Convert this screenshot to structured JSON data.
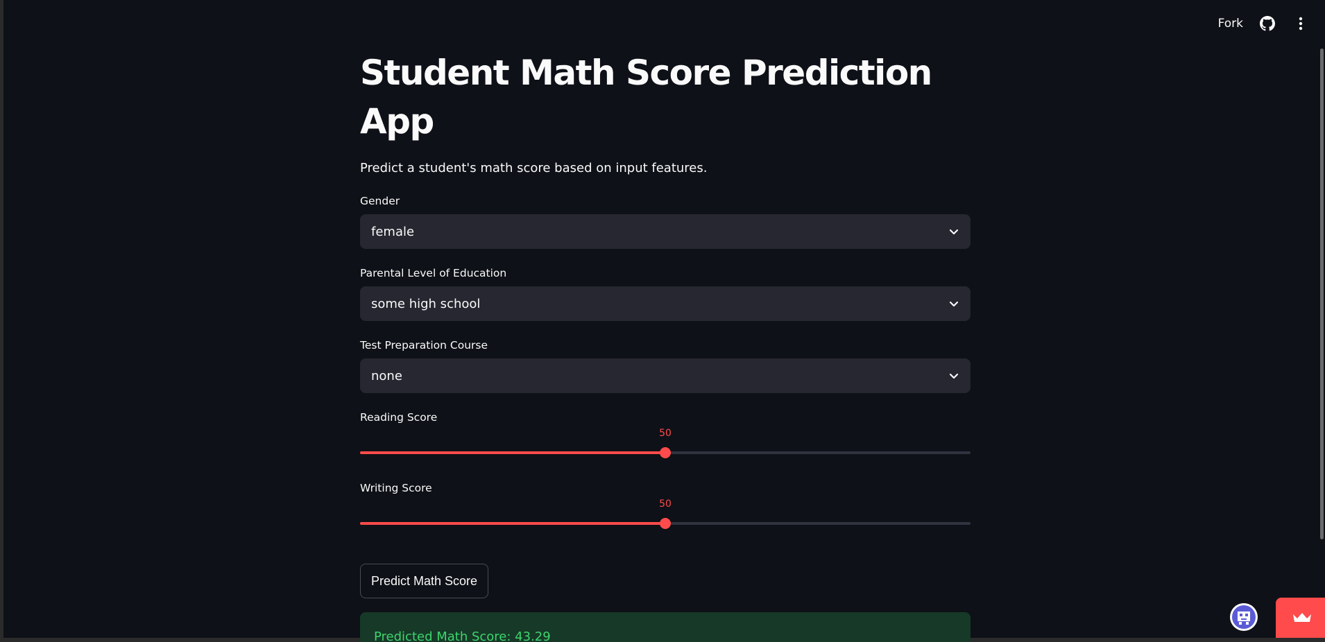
{
  "header": {
    "fork_label": "Fork",
    "github_icon": "github-icon",
    "menu_icon": "more-vertical-icon"
  },
  "main": {
    "title": "Student Math Score Prediction App",
    "subtitle": "Predict a student's math score based on input features.",
    "gender": {
      "label": "Gender",
      "value": "female"
    },
    "education": {
      "label": "Parental Level of Education",
      "value": "some high school"
    },
    "prep_course": {
      "label": "Test Preparation Course",
      "value": "none"
    },
    "reading": {
      "label": "Reading Score",
      "value": "50",
      "min": 0,
      "max": 100
    },
    "writing": {
      "label": "Writing Score",
      "value": "50",
      "min": 0,
      "max": 100
    },
    "predict_button": "Predict Math Score",
    "result": "Predicted Math Score: 43.29"
  },
  "colors": {
    "background": "#0e1117",
    "accent": "#ff4b4b",
    "select_bg": "#262730",
    "success_bg": "#173928",
    "success_text": "#3dd56d"
  }
}
